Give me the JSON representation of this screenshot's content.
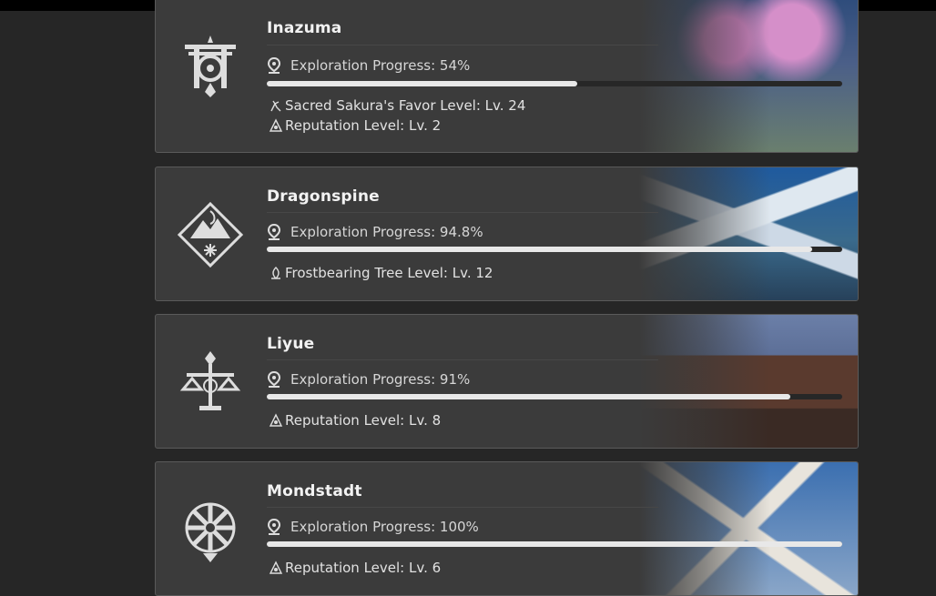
{
  "regions": [
    {
      "name": "Inazuma",
      "progress_label": "Exploration Progress: 54%",
      "progress": 0.54,
      "levels": [
        {
          "icon": "sakura-tree-icon",
          "text": "Sacred Sakura's Favor Level: Lv. 24"
        },
        {
          "icon": "reputation-icon",
          "text": "Reputation Level: Lv. 2"
        }
      ],
      "art_colors": [
        "#2b4a7a",
        "#d58fc9",
        "#6a7f6e"
      ]
    },
    {
      "name": "Dragonspine",
      "progress_label": "Exploration Progress: 94.8%",
      "progress": 0.948,
      "levels": [
        {
          "icon": "frostbearing-tree-icon",
          "text": "Frostbearing Tree Level: Lv. 12"
        }
      ],
      "art_colors": [
        "#1f5a9e",
        "#dfe8f0",
        "#3a6a8c"
      ]
    },
    {
      "name": "Liyue",
      "progress_label": "Exploration Progress: 91%",
      "progress": 0.91,
      "levels": [
        {
          "icon": "reputation-icon",
          "text": "Reputation Level: Lv. 8"
        }
      ],
      "art_colors": [
        "#6b7fa8",
        "#5a3a2e",
        "#b6874f"
      ]
    },
    {
      "name": "Mondstadt",
      "progress_label": "Exploration Progress: 100%",
      "progress": 1.0,
      "levels": [
        {
          "icon": "reputation-icon",
          "text": "Reputation Level: Lv. 6"
        }
      ],
      "art_colors": [
        "#3b6fb0",
        "#e8e4dc",
        "#8aa6c8"
      ]
    }
  ]
}
